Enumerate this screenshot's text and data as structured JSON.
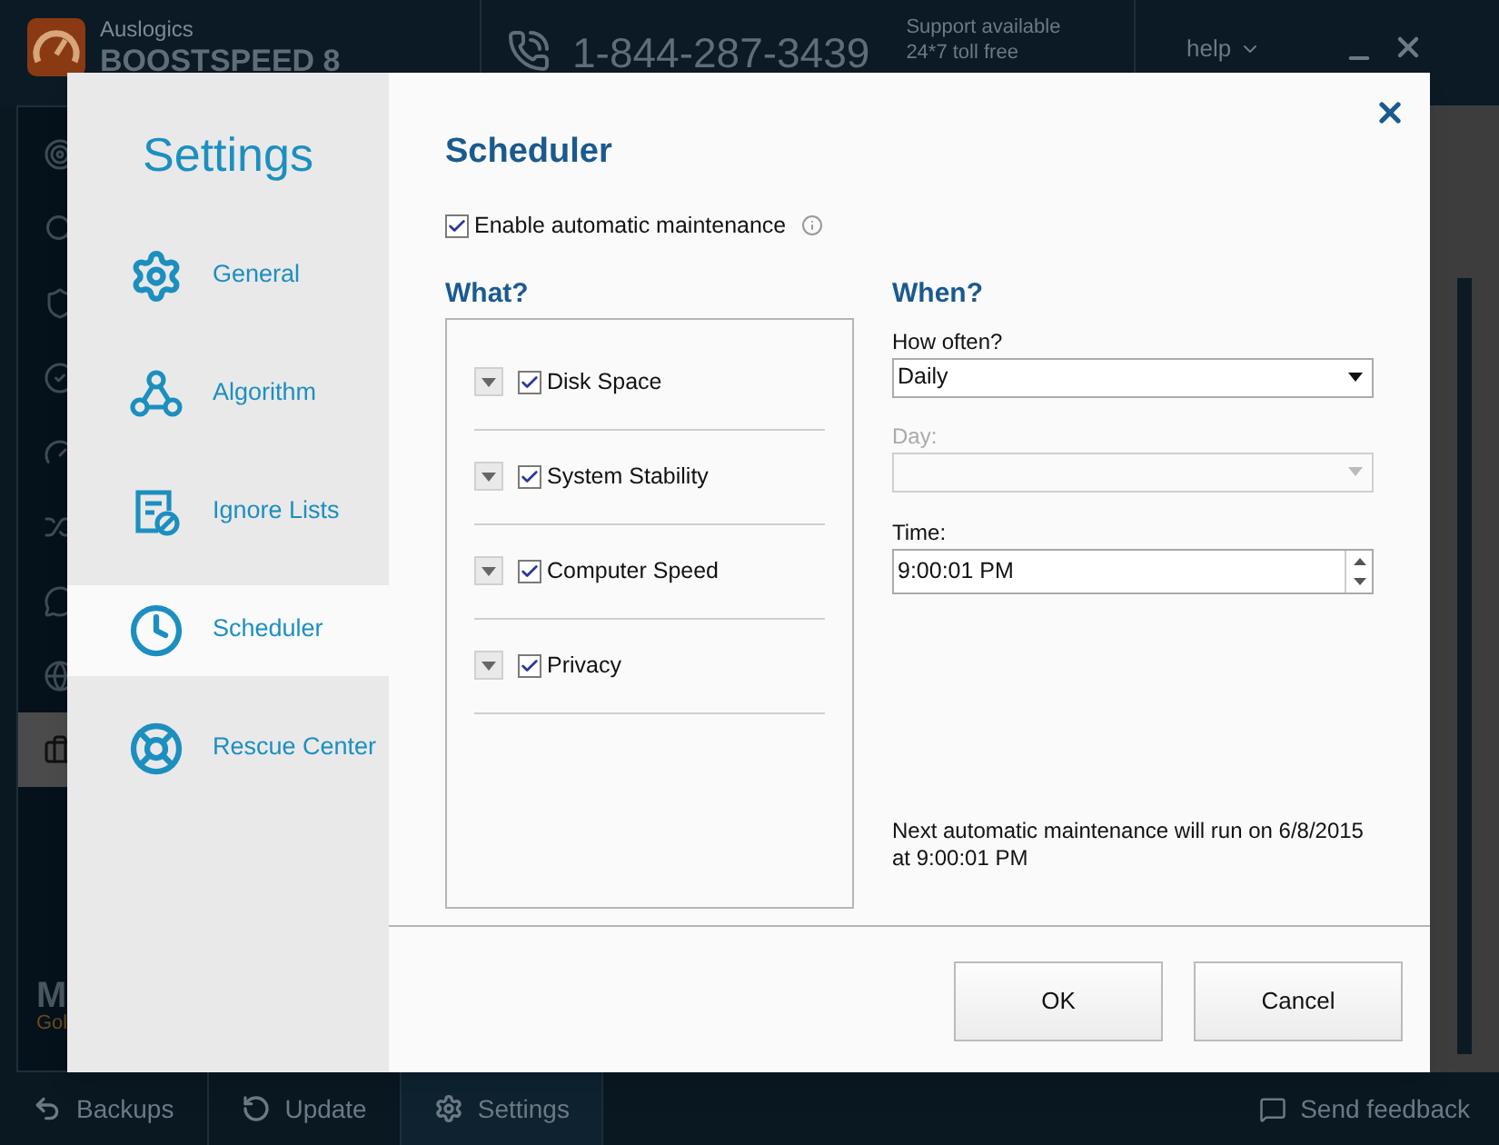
{
  "app": {
    "brand_small": "Auslogics",
    "brand_large": "BOOSTSPEED 8",
    "phone": "1-844-287-3439",
    "support_lines": [
      "Support available",
      "24*7 toll free"
    ],
    "help_menu": "help"
  },
  "nav_items": [
    {
      "kind": "target",
      "selected": false
    },
    {
      "kind": "search",
      "selected": false
    },
    {
      "kind": "shield",
      "selected": false
    },
    {
      "kind": "check",
      "selected": false
    },
    {
      "kind": "gauge",
      "selected": false
    },
    {
      "kind": "shuffle",
      "selected": false
    },
    {
      "kind": "chat",
      "selected": false
    },
    {
      "kind": "globe",
      "selected": false
    },
    {
      "kind": "briefcase",
      "selected": true
    }
  ],
  "profile": {
    "name": "M",
    "subtitle": "Gol"
  },
  "bottom_bar": {
    "buttons": [
      {
        "kind": "backups",
        "label": "Backups",
        "selected": false
      },
      {
        "kind": "update",
        "label": "Update",
        "selected": false
      },
      {
        "kind": "settings",
        "label": "Settings",
        "selected": true
      }
    ],
    "feedback": "Send feedback"
  },
  "dialog": {
    "title": "Settings",
    "nav": [
      {
        "kind": "gear",
        "label": "General",
        "selected": false
      },
      {
        "kind": "algorithm",
        "label": "Algorithm",
        "selected": false
      },
      {
        "kind": "ignore",
        "label": "Ignore Lists",
        "selected": false
      },
      {
        "kind": "clock",
        "label": "Scheduler",
        "selected": true
      },
      {
        "kind": "lifebuoy",
        "label": "Rescue Center",
        "selected": false
      }
    ],
    "page_title": "Scheduler",
    "enable": {
      "label": "Enable automatic maintenance",
      "checked": true
    },
    "what": {
      "heading": "What?",
      "items": [
        {
          "label": "Disk Space",
          "checked": true
        },
        {
          "label": "System Stability",
          "checked": true
        },
        {
          "label": "Computer Speed",
          "checked": true
        },
        {
          "label": "Privacy",
          "checked": true
        }
      ]
    },
    "when": {
      "heading": "When?",
      "how_often": {
        "label": "How often?",
        "value": "Daily",
        "disabled": false
      },
      "day": {
        "label": "Day:",
        "disabled": true
      },
      "time": {
        "label": "Time:",
        "value": "9:00:01 PM"
      },
      "note": "Next automatic maintenance will run on 6/8/2015 at 9:00:01 PM"
    },
    "buttons": [
      {
        "label": "OK"
      },
      {
        "label": "Cancel"
      }
    ]
  }
}
